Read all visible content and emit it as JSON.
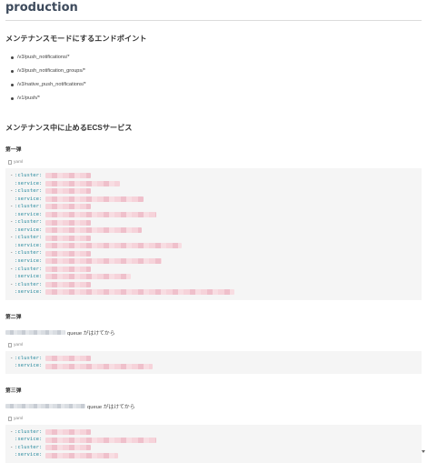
{
  "page": {
    "title": "production"
  },
  "maintenance_endpoints": {
    "heading": "メンテナンスモードにするエンドポイント",
    "items": [
      "/v3/push_notifications/*",
      "/v3/push_notification_groups/*",
      "/v3/native_push_notifications/*",
      "/v1/push/*"
    ]
  },
  "ecs_services": {
    "heading": "メンテナンス中に止めるECSサービス",
    "phase1": {
      "title": "第一弾",
      "code_lang": "yaml",
      "lines": [
        {
          "dash": "-",
          "key": ":cluster:",
          "redact_len": 50
        },
        {
          "dash": "",
          "key": ":service:",
          "redact_len": 82
        },
        {
          "dash": "-",
          "key": ":cluster:",
          "redact_len": 50
        },
        {
          "dash": "",
          "key": ":service:",
          "redact_len": 108
        },
        {
          "dash": "-",
          "key": ":cluster:",
          "redact_len": 50
        },
        {
          "dash": "",
          "key": ":service:",
          "redact_len": 122
        },
        {
          "dash": "-",
          "key": ":cluster:",
          "redact_len": 50
        },
        {
          "dash": "",
          "key": ":service:",
          "redact_len": 106
        },
        {
          "dash": "-",
          "key": ":cluster:",
          "redact_len": 50
        },
        {
          "dash": "",
          "key": ":service:",
          "redact_len": 150
        },
        {
          "dash": "-",
          "key": ":cluster:",
          "redact_len": 50
        },
        {
          "dash": "",
          "key": ":service:",
          "redact_len": 128
        },
        {
          "dash": "-",
          "key": ":cluster:",
          "redact_len": 50
        },
        {
          "dash": "",
          "key": ":service:",
          "redact_len": 94
        },
        {
          "dash": "-",
          "key": ":cluster:",
          "redact_len": 50
        },
        {
          "dash": "",
          "key": ":service:",
          "redact_len": 208
        }
      ]
    },
    "phase2": {
      "title": "第二弾",
      "note_suffix": "queue がはけてから",
      "code_lang": "yaml",
      "lines": [
        {
          "dash": "-",
          "key": ":cluster:",
          "redact_len": 50
        },
        {
          "dash": "",
          "key": ":service:",
          "redact_len": 118
        }
      ]
    },
    "phase3": {
      "title": "第三弾",
      "note_suffix": "queue がはけてから",
      "code_lang": "yaml",
      "lines": [
        {
          "dash": "-",
          "key": ":cluster:",
          "redact_len": 50
        },
        {
          "dash": "",
          "key": ":service:",
          "redact_len": 122
        },
        {
          "dash": "-",
          "key": ":cluster:",
          "redact_len": 50
        },
        {
          "dash": "",
          "key": ":service:",
          "redact_len": 80
        }
      ]
    }
  }
}
